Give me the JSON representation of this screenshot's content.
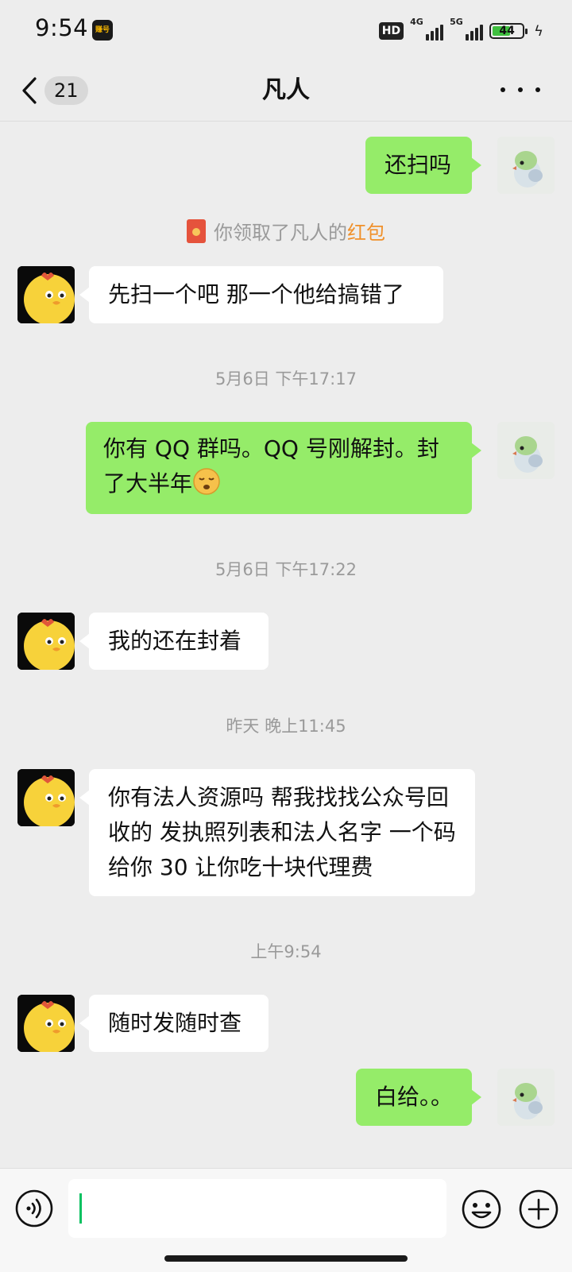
{
  "status_bar": {
    "time": "9:54",
    "app_badge": "赚号",
    "hd_label": "HD",
    "signal_1_label": "4G",
    "signal_2_label": "5G",
    "battery_level": "44"
  },
  "nav": {
    "unread_count": "21",
    "title": "凡人"
  },
  "messages": [
    {
      "type": "sent",
      "text": "还扫吗"
    },
    {
      "type": "system",
      "text_prefix": "你领取了凡人的",
      "text_link": "红包"
    },
    {
      "type": "received",
      "text": "先扫一个吧 那一个他给搞错了"
    },
    {
      "type": "time",
      "text": "5月6日 下午17:17"
    },
    {
      "type": "sent",
      "text": "你有 QQ 群吗。QQ 号刚解封。封了大半年"
    },
    {
      "type": "time",
      "text": "5月6日 下午17:22"
    },
    {
      "type": "received",
      "text": "我的还在封着"
    },
    {
      "type": "time",
      "text": "昨天 晚上11:45"
    },
    {
      "type": "received",
      "text": "你有法人资源吗 帮我找找公众号回收的 发执照列表和法人名字 一个码给你 30 让你吃十块代理费"
    },
    {
      "type": "time",
      "text": "上午9:54"
    },
    {
      "type": "received",
      "text": "随时发随时查"
    },
    {
      "type": "sent",
      "text": "白给。。"
    }
  ],
  "icons": {
    "back": "chevron-left-icon",
    "more": "more-horizontal-icon",
    "voice": "voice-icon",
    "emoji": "smiley-icon",
    "plus": "plus-circle-icon",
    "red_packet": "red-packet-icon"
  },
  "colors": {
    "sent_bubble": "#95ec69",
    "received_bubble": "#ffffff",
    "background": "#ededed",
    "red_packet_link": "#f0902a",
    "cursor": "#07c160"
  },
  "input": {
    "value": ""
  }
}
